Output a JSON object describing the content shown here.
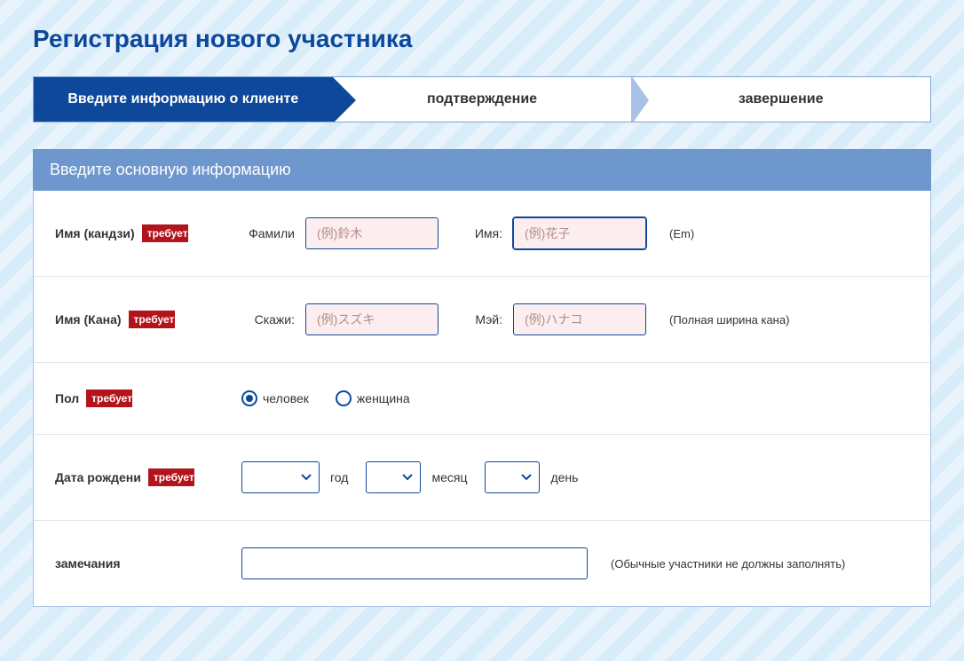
{
  "title": "Регистрация нового участника",
  "steps": {
    "s1": "Введите информацию о клиенте",
    "s2": "подтверждение",
    "s3": "завершение"
  },
  "section_header": "Введите основную информацию",
  "required_label": "требует",
  "fields": {
    "name_kanji": {
      "label": "Имя (кандзи)",
      "family_label": "Фамили",
      "family_placeholder": "(例)鈴木",
      "given_label": "Имя:",
      "given_placeholder": "(例)花子",
      "hint": "(Em)"
    },
    "name_kana": {
      "label": "Имя (Кана)",
      "family_label": "Скажи:",
      "family_placeholder": "(例)スズキ",
      "given_label": "Мэй:",
      "given_placeholder": "(例)ハナコ",
      "hint": "(Полная ширина кана)"
    },
    "gender": {
      "label": "Пол",
      "option_male": "человек",
      "option_female": "женщина"
    },
    "birthdate": {
      "label": "Дата рождени",
      "year": "год",
      "month": "месяц",
      "day": "день"
    },
    "remarks": {
      "label": "замечания",
      "hint": "(Обычные участники не должны заполнять)"
    }
  }
}
